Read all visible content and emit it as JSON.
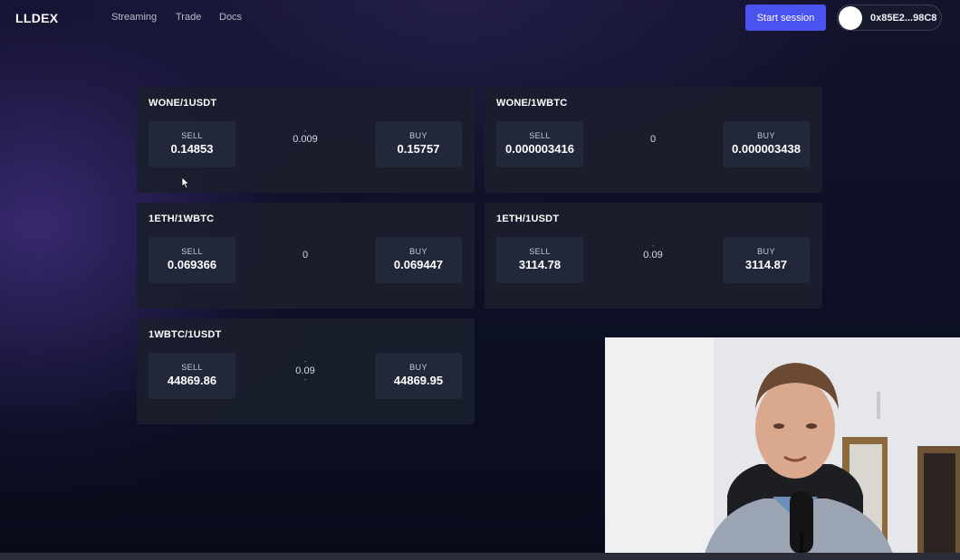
{
  "header": {
    "logo": "LLDEX",
    "nav": [
      "Streaming",
      "Trade",
      "Docs"
    ],
    "start_session": "Start session",
    "wallet_address": "0x85E2...98C8"
  },
  "pairs": [
    {
      "name": "WONE/1USDT",
      "sell_label": "SELL",
      "sell": "0.14853",
      "spread": "0.009",
      "spread_marks": true,
      "buy_label": "BUY",
      "buy": "0.15757"
    },
    {
      "name": "WONE/1WBTC",
      "sell_label": "SELL",
      "sell": "0.000003416",
      "spread": "0",
      "spread_marks": false,
      "buy_label": "BUY",
      "buy": "0.000003438"
    },
    {
      "name": "1ETH/1WBTC",
      "sell_label": "SELL",
      "sell": "0.069366",
      "spread": "0",
      "spread_marks": false,
      "buy_label": "BUY",
      "buy": "0.069447"
    },
    {
      "name": "1ETH/1USDT",
      "sell_label": "SELL",
      "sell": "3114.78",
      "spread": "0.09",
      "spread_marks": true,
      "buy_label": "BUY",
      "buy": "3114.87"
    },
    {
      "name": "1WBTC/1USDT",
      "sell_label": "SELL",
      "sell": "44869.86",
      "spread": "0.09",
      "spread_marks": true,
      "buy_label": "BUY",
      "buy": "44869.95"
    }
  ],
  "colors": {
    "accent": "#4a52ef",
    "card_bg": "#1a1e2c",
    "price_box_bg": "#22273a"
  },
  "icons": {
    "cursor": "mouse-pointer-icon",
    "wallet_avatar": "avatar-circle"
  }
}
